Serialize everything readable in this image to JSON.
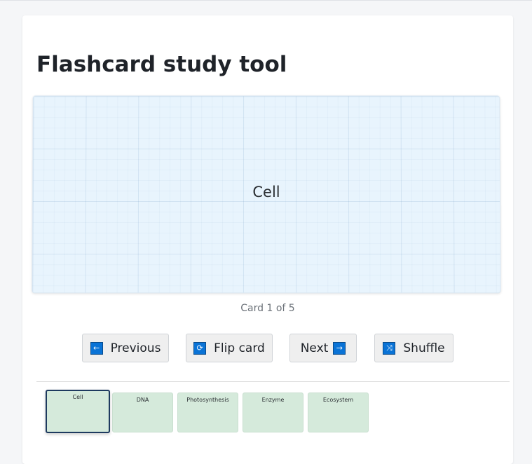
{
  "page": {
    "title": "Flashcard study tool"
  },
  "card": {
    "text": "Cell"
  },
  "counter": "Card 1 of 5",
  "buttons": {
    "previous": {
      "label": "Previous",
      "icon": "arrow-left-icon",
      "glyph": "←"
    },
    "flip": {
      "label": "Flip card",
      "icon": "refresh-icon",
      "glyph": "⟳"
    },
    "next": {
      "label": "Next",
      "icon": "arrow-right-icon",
      "glyph": "→"
    },
    "shuffle": {
      "label": "Shuffle",
      "icon": "shuffle-icon",
      "glyph": "⤨"
    }
  },
  "thumbnails": [
    {
      "label": "Cell",
      "active": true
    },
    {
      "label": "DNA",
      "active": false
    },
    {
      "label": "Photosynthesis",
      "active": false
    },
    {
      "label": "Enzyme",
      "active": false
    },
    {
      "label": "Ecosystem",
      "active": false
    }
  ],
  "colors": {
    "card_background": "#e8f4fd",
    "thumbnail_background": "#d5eadb",
    "active_border": "#1e3a5f",
    "icon_blue": "#0a73d6"
  }
}
